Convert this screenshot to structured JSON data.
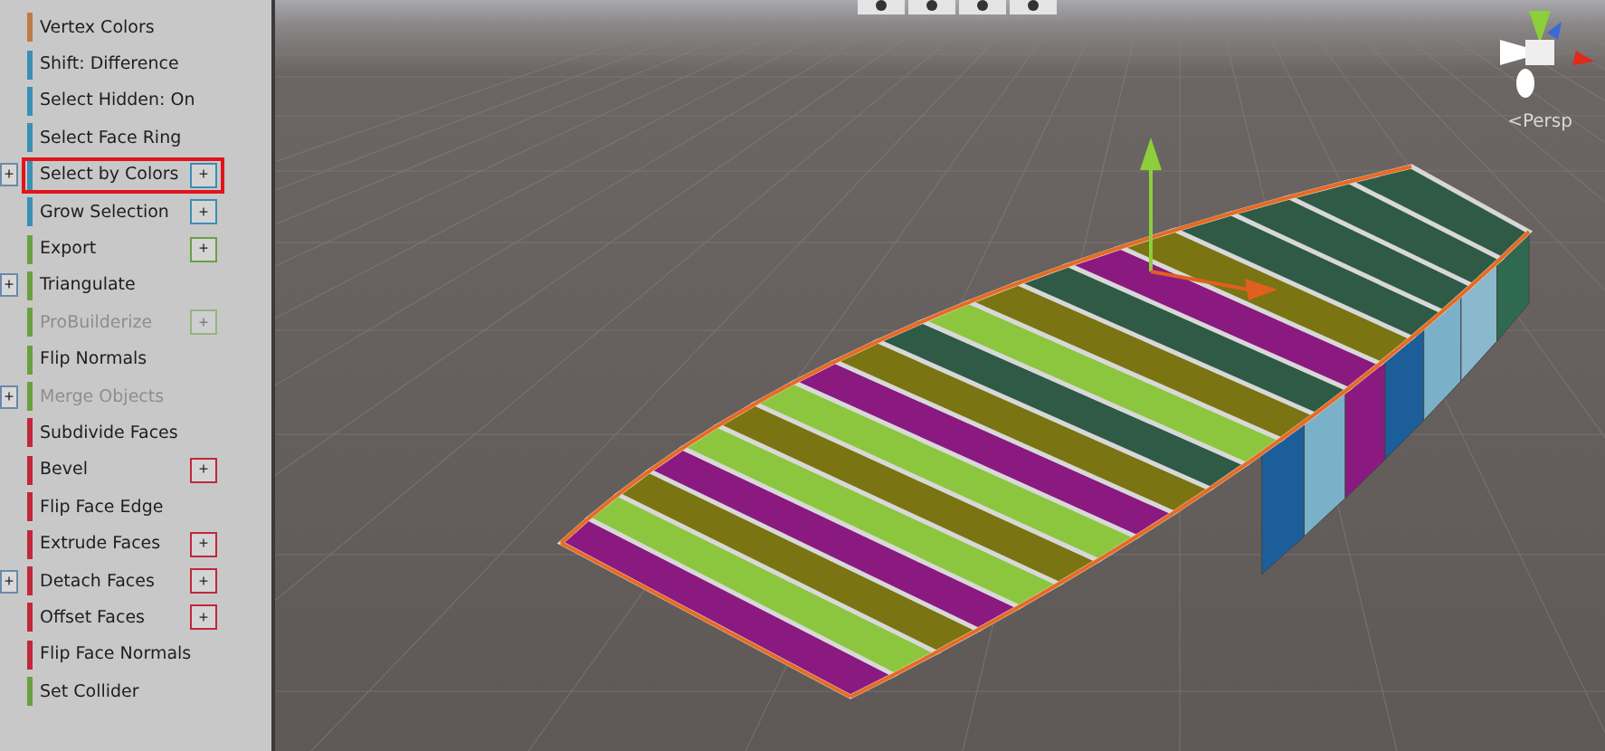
{
  "sidebar": {
    "items": [
      {
        "label": "Vertex Colors",
        "color": "#c07a4a",
        "disabled": false,
        "highlighted": false
      },
      {
        "label": "Shift: Difference",
        "color": "#3a8fb5",
        "disabled": false,
        "highlighted": false
      },
      {
        "label": "Select Hidden: On",
        "color": "#3a8fb5",
        "disabled": false,
        "highlighted": false
      },
      {
        "label": "Select Face Ring",
        "color": "#3a8fb5",
        "disabled": false,
        "highlighted": false
      },
      {
        "label": "Select by Colors",
        "color": "#3a8fb5",
        "disabled": false,
        "highlighted": true,
        "option": "+",
        "side_option": "+"
      },
      {
        "label": "Grow Selection",
        "color": "#3a8fb5",
        "disabled": false,
        "highlighted": false,
        "option": "+"
      },
      {
        "label": "Export",
        "color": "#6aa040",
        "disabled": false,
        "highlighted": false,
        "option": "+"
      },
      {
        "label": "Triangulate",
        "color": "#6aa040",
        "disabled": false,
        "highlighted": false,
        "side_option": "+"
      },
      {
        "label": "ProBuilderize",
        "color": "#6aa040",
        "disabled": true,
        "highlighted": false,
        "option": "+"
      },
      {
        "label": "Flip Normals",
        "color": "#6aa040",
        "disabled": false,
        "highlighted": false
      },
      {
        "label": "Merge Objects",
        "color": "#6aa040",
        "disabled": true,
        "highlighted": false,
        "side_option": "+"
      },
      {
        "label": "Subdivide Faces",
        "color": "#c0283a",
        "disabled": false,
        "highlighted": false
      },
      {
        "label": "Bevel",
        "color": "#c0283a",
        "disabled": false,
        "highlighted": false,
        "option": "+"
      },
      {
        "label": "Flip Face Edge",
        "color": "#c0283a",
        "disabled": false,
        "highlighted": false
      },
      {
        "label": "Extrude Faces",
        "color": "#c0283a",
        "disabled": false,
        "highlighted": false,
        "option": "+"
      },
      {
        "label": "Detach Faces",
        "color": "#c0283a",
        "disabled": false,
        "highlighted": false,
        "option": "+",
        "side_option": "+"
      },
      {
        "label": "Offset Faces",
        "color": "#c0283a",
        "disabled": false,
        "highlighted": false,
        "option": "+"
      },
      {
        "label": "Flip Face Normals",
        "color": "#c0283a",
        "disabled": false,
        "highlighted": false
      },
      {
        "label": "Set Collider",
        "color": "#6aa040",
        "disabled": false,
        "highlighted": false
      }
    ]
  },
  "viewport": {
    "camera_label": "<Persp"
  }
}
